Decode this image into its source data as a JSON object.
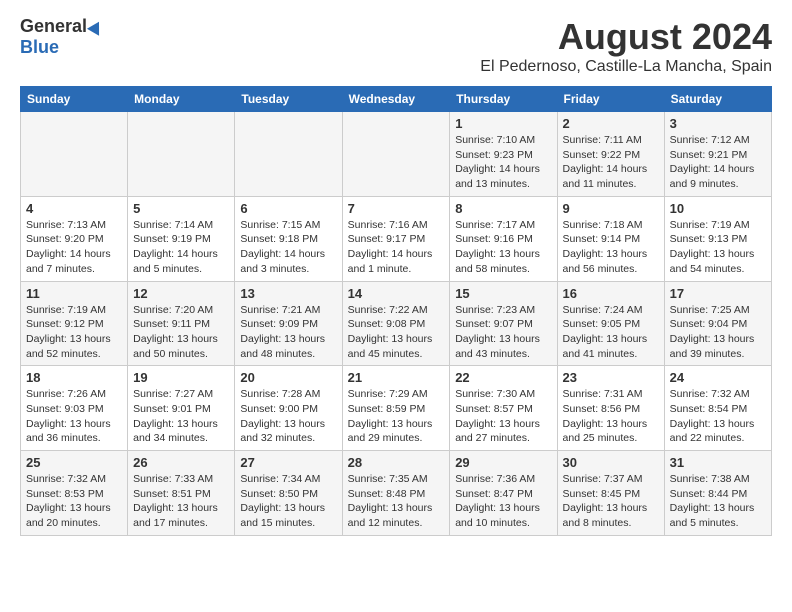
{
  "logo": {
    "general": "General",
    "blue": "Blue"
  },
  "title": "August 2024",
  "subtitle": "El Pedernoso, Castille-La Mancha, Spain",
  "headers": [
    "Sunday",
    "Monday",
    "Tuesday",
    "Wednesday",
    "Thursday",
    "Friday",
    "Saturday"
  ],
  "weeks": [
    [
      {
        "day": "",
        "info": ""
      },
      {
        "day": "",
        "info": ""
      },
      {
        "day": "",
        "info": ""
      },
      {
        "day": "",
        "info": ""
      },
      {
        "day": "1",
        "info": "Sunrise: 7:10 AM\nSunset: 9:23 PM\nDaylight: 14 hours\nand 13 minutes."
      },
      {
        "day": "2",
        "info": "Sunrise: 7:11 AM\nSunset: 9:22 PM\nDaylight: 14 hours\nand 11 minutes."
      },
      {
        "day": "3",
        "info": "Sunrise: 7:12 AM\nSunset: 9:21 PM\nDaylight: 14 hours\nand 9 minutes."
      }
    ],
    [
      {
        "day": "4",
        "info": "Sunrise: 7:13 AM\nSunset: 9:20 PM\nDaylight: 14 hours\nand 7 minutes."
      },
      {
        "day": "5",
        "info": "Sunrise: 7:14 AM\nSunset: 9:19 PM\nDaylight: 14 hours\nand 5 minutes."
      },
      {
        "day": "6",
        "info": "Sunrise: 7:15 AM\nSunset: 9:18 PM\nDaylight: 14 hours\nand 3 minutes."
      },
      {
        "day": "7",
        "info": "Sunrise: 7:16 AM\nSunset: 9:17 PM\nDaylight: 14 hours\nand 1 minute."
      },
      {
        "day": "8",
        "info": "Sunrise: 7:17 AM\nSunset: 9:16 PM\nDaylight: 13 hours\nand 58 minutes."
      },
      {
        "day": "9",
        "info": "Sunrise: 7:18 AM\nSunset: 9:14 PM\nDaylight: 13 hours\nand 56 minutes."
      },
      {
        "day": "10",
        "info": "Sunrise: 7:19 AM\nSunset: 9:13 PM\nDaylight: 13 hours\nand 54 minutes."
      }
    ],
    [
      {
        "day": "11",
        "info": "Sunrise: 7:19 AM\nSunset: 9:12 PM\nDaylight: 13 hours\nand 52 minutes."
      },
      {
        "day": "12",
        "info": "Sunrise: 7:20 AM\nSunset: 9:11 PM\nDaylight: 13 hours\nand 50 minutes."
      },
      {
        "day": "13",
        "info": "Sunrise: 7:21 AM\nSunset: 9:09 PM\nDaylight: 13 hours\nand 48 minutes."
      },
      {
        "day": "14",
        "info": "Sunrise: 7:22 AM\nSunset: 9:08 PM\nDaylight: 13 hours\nand 45 minutes."
      },
      {
        "day": "15",
        "info": "Sunrise: 7:23 AM\nSunset: 9:07 PM\nDaylight: 13 hours\nand 43 minutes."
      },
      {
        "day": "16",
        "info": "Sunrise: 7:24 AM\nSunset: 9:05 PM\nDaylight: 13 hours\nand 41 minutes."
      },
      {
        "day": "17",
        "info": "Sunrise: 7:25 AM\nSunset: 9:04 PM\nDaylight: 13 hours\nand 39 minutes."
      }
    ],
    [
      {
        "day": "18",
        "info": "Sunrise: 7:26 AM\nSunset: 9:03 PM\nDaylight: 13 hours\nand 36 minutes."
      },
      {
        "day": "19",
        "info": "Sunrise: 7:27 AM\nSunset: 9:01 PM\nDaylight: 13 hours\nand 34 minutes."
      },
      {
        "day": "20",
        "info": "Sunrise: 7:28 AM\nSunset: 9:00 PM\nDaylight: 13 hours\nand 32 minutes."
      },
      {
        "day": "21",
        "info": "Sunrise: 7:29 AM\nSunset: 8:59 PM\nDaylight: 13 hours\nand 29 minutes."
      },
      {
        "day": "22",
        "info": "Sunrise: 7:30 AM\nSunset: 8:57 PM\nDaylight: 13 hours\nand 27 minutes."
      },
      {
        "day": "23",
        "info": "Sunrise: 7:31 AM\nSunset: 8:56 PM\nDaylight: 13 hours\nand 25 minutes."
      },
      {
        "day": "24",
        "info": "Sunrise: 7:32 AM\nSunset: 8:54 PM\nDaylight: 13 hours\nand 22 minutes."
      }
    ],
    [
      {
        "day": "25",
        "info": "Sunrise: 7:32 AM\nSunset: 8:53 PM\nDaylight: 13 hours\nand 20 minutes."
      },
      {
        "day": "26",
        "info": "Sunrise: 7:33 AM\nSunset: 8:51 PM\nDaylight: 13 hours\nand 17 minutes."
      },
      {
        "day": "27",
        "info": "Sunrise: 7:34 AM\nSunset: 8:50 PM\nDaylight: 13 hours\nand 15 minutes."
      },
      {
        "day": "28",
        "info": "Sunrise: 7:35 AM\nSunset: 8:48 PM\nDaylight: 13 hours\nand 12 minutes."
      },
      {
        "day": "29",
        "info": "Sunrise: 7:36 AM\nSunset: 8:47 PM\nDaylight: 13 hours\nand 10 minutes."
      },
      {
        "day": "30",
        "info": "Sunrise: 7:37 AM\nSunset: 8:45 PM\nDaylight: 13 hours\nand 8 minutes."
      },
      {
        "day": "31",
        "info": "Sunrise: 7:38 AM\nSunset: 8:44 PM\nDaylight: 13 hours\nand 5 minutes."
      }
    ]
  ]
}
